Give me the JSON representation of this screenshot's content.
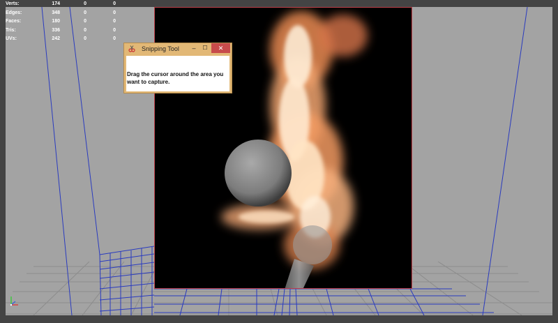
{
  "hud": {
    "rows": [
      {
        "label": "Verts:",
        "v1": "174",
        "v2": "0",
        "v3": "0"
      },
      {
        "label": "Edges:",
        "v1": "348",
        "v2": "0",
        "v3": "0"
      },
      {
        "label": "Faces:",
        "v1": "180",
        "v2": "0",
        "v3": "0"
      },
      {
        "label": "Tris:",
        "v1": "336",
        "v2": "0",
        "v3": "0"
      },
      {
        "label": "UVs:",
        "v1": "242",
        "v2": "0",
        "v3": "0"
      }
    ]
  },
  "snipping_tool": {
    "title": "Snipping Tool",
    "minimize": "–",
    "maximize": "☐",
    "close": "✕",
    "message": "Drag the cursor around the area you want to capture."
  },
  "colors": {
    "viewport_bg": "#a3a3a3",
    "grid_blue": "#2a3bbf",
    "render_border": "#c0404a",
    "snip_frame": "#e2b876",
    "close_red": "#c74b4b"
  }
}
